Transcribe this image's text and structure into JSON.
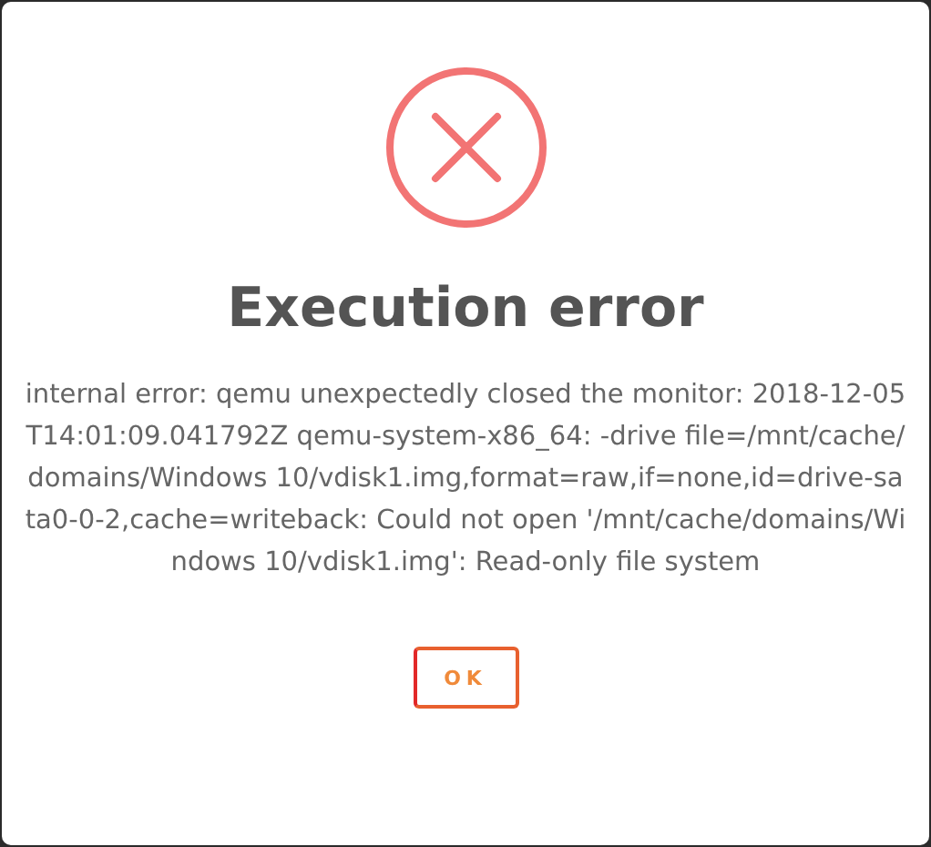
{
  "dialog": {
    "title": "Execution error",
    "message": "internal error: qemu unexpectedly closed the monitor: 2018-12-05T14:01:09.041792Z qemu-system-x86_64: -drive file=/mnt/cache/domains/Windows 10/vdisk1.img,format=raw,if=none,id=drive-sata0-0-2,cache=writeback: Could not open '/mnt/cache/domains/Windows 10/vdisk1.img': Read-only file system",
    "buttons": [
      "OK"
    ]
  }
}
